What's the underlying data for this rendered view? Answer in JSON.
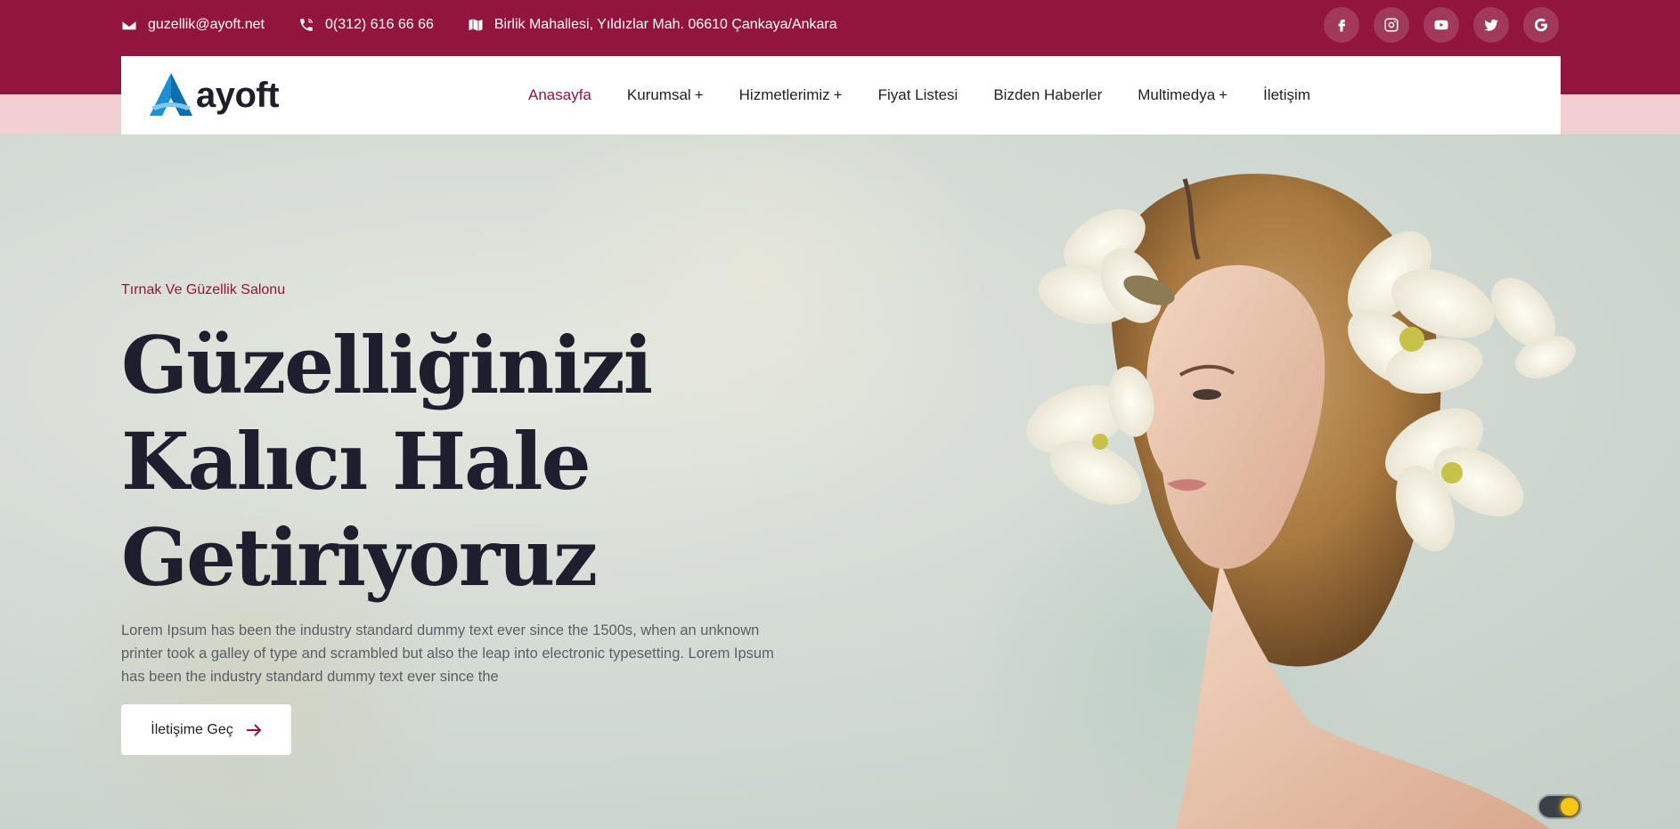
{
  "topbar": {
    "email": "guzellik@ayoft.net",
    "phone": "0(312) 616 66 66",
    "address": "Birlik Mahallesi, Yıldızlar Mah. 06610 Çankaya/Ankara",
    "socials": [
      "facebook-icon",
      "instagram-icon",
      "youtube-icon",
      "twitter-icon",
      "google-icon"
    ]
  },
  "brand": {
    "name": "ayoft"
  },
  "nav": {
    "items": [
      {
        "label": "Anasayfa",
        "has_sub": false,
        "active": true
      },
      {
        "label": "Kurumsal",
        "has_sub": true
      },
      {
        "label": "Hizmetlerimiz",
        "has_sub": true
      },
      {
        "label": "Fiyat Listesi",
        "has_sub": false
      },
      {
        "label": "Bizden Haberler",
        "has_sub": false
      },
      {
        "label": "Multimedya",
        "has_sub": true
      },
      {
        "label": "İletişim",
        "has_sub": false
      }
    ],
    "sub_indicator": "+"
  },
  "hero": {
    "eyebrow": "Tırnak Ve Güzellik Salonu",
    "headline": [
      "Güzelliğinizi",
      "Kalıcı Hale",
      "Getiriyoruz"
    ],
    "description": "Lorem Ipsum has been the industry standard dummy text ever since the 1500s, when an unknown printer took a galley of type and scrambled but also the leap into electronic typesetting. Lorem Ipsum has been the industry standard dummy text ever since the",
    "cta_label": "İletişime Geç"
  },
  "colors": {
    "brand": "#91153c",
    "topbar_band": "#f2d0d2",
    "headline": "#1e1e2e"
  }
}
